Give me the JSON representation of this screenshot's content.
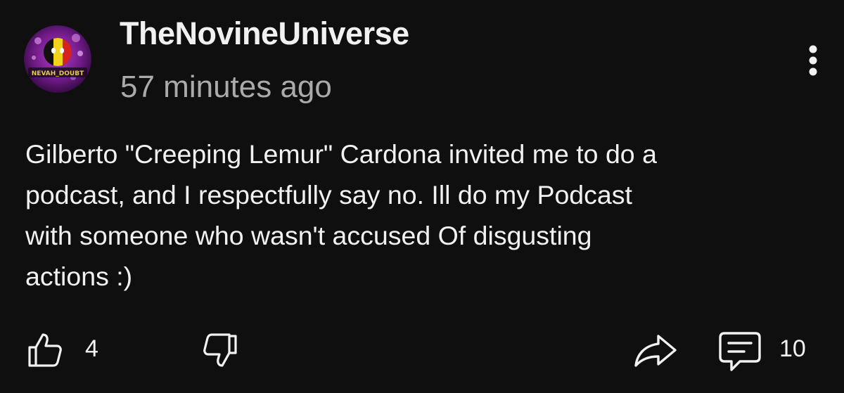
{
  "post": {
    "author": "TheNovineUniverse",
    "timestamp": "57 minutes ago",
    "avatar_badge_text": "NEVAH_DOUBT",
    "text": "Gilberto \"Creeping Lemur\" Cardona invited me to do a\npodcast, and I respectfully say no. Ill do my Podcast\nwith someone who wasn't accused Of disgusting\nactions :)"
  },
  "actions": {
    "like_count": "4",
    "comment_count": "10",
    "icons": {
      "more": "more-vertical-icon",
      "like": "thumbs-up-icon",
      "dislike": "thumbs-down-icon",
      "share": "share-arrow-icon",
      "comments": "comment-icon"
    }
  },
  "colors": {
    "background": "#0f0f0f",
    "primary_text": "#f1f1f1",
    "secondary_text": "#aaaaaa",
    "avatar_purple": "#7a1d8c"
  }
}
